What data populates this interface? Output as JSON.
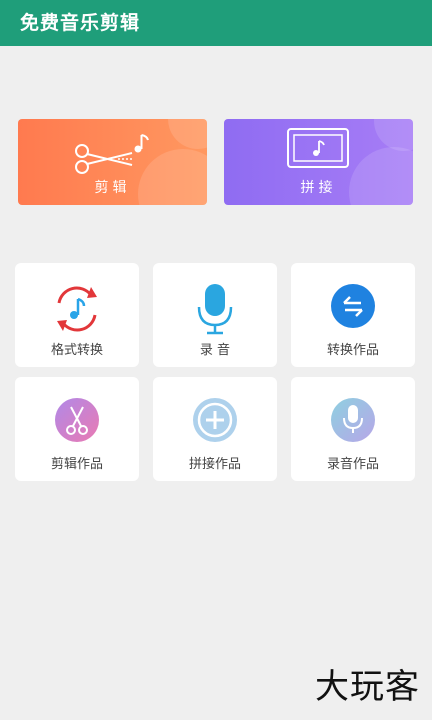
{
  "app": {
    "title": "免费音乐剪辑"
  },
  "top_cards": [
    {
      "label": "剪辑",
      "icon": "scissors-music-icon",
      "color_from": "#ff7a4f",
      "color_to": "#ff9860"
    },
    {
      "label": "拼接",
      "icon": "screen-music-icon",
      "color_from": "#8f6cf2",
      "color_to": "#a77df6"
    }
  ],
  "grid": [
    {
      "label": "格式转换",
      "icon": "format-convert-icon"
    },
    {
      "label": "录 音",
      "icon": "microphone-icon"
    },
    {
      "label": "转换作品",
      "icon": "converted-works-icon"
    },
    {
      "label": "剪辑作品",
      "icon": "edited-works-icon"
    },
    {
      "label": "拼接作品",
      "icon": "joined-works-icon"
    },
    {
      "label": "录音作品",
      "icon": "recorded-works-icon"
    }
  ],
  "watermark": "大玩客"
}
